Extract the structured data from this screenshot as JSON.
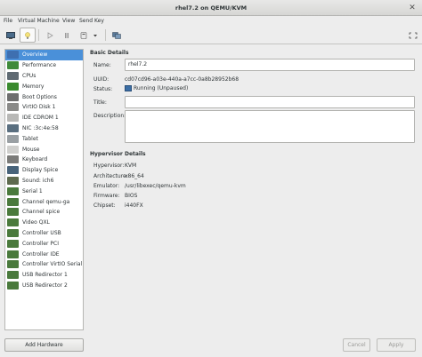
{
  "window": {
    "title": "rhel7.2 on QEMU/KVM"
  },
  "menu": [
    "File",
    "Virtual Machine",
    "View",
    "Send Key"
  ],
  "toolbar": {
    "buttons": [
      {
        "name": "console-icon"
      },
      {
        "name": "lightbulb-icon"
      },
      {
        "name": "play-icon"
      },
      {
        "name": "pause-icon"
      },
      {
        "name": "power-icon"
      },
      {
        "name": "chevron-down-icon"
      },
      {
        "name": "snapshot-icon"
      }
    ]
  },
  "sidebar": {
    "items": [
      {
        "label": "Overview",
        "icon": "overview-icon",
        "color": "#3e6fb0"
      },
      {
        "label": "Performance",
        "icon": "performance-icon",
        "color": "#3f8a3a"
      },
      {
        "label": "CPUs",
        "icon": "cpu-icon",
        "color": "#5f6a72"
      },
      {
        "label": "Memory",
        "icon": "memory-icon",
        "color": "#3a8a2e"
      },
      {
        "label": "Boot Options",
        "icon": "gear-icon",
        "color": "#6e6e6e"
      },
      {
        "label": "VirtIO Disk 1",
        "icon": "disk-icon",
        "color": "#8a8a88"
      },
      {
        "label": "IDE CDROM 1",
        "icon": "cdrom-icon",
        "color": "#b8b8b6"
      },
      {
        "label": "NIC :3c:4e:58",
        "icon": "nic-icon",
        "color": "#5a6f80"
      },
      {
        "label": "Tablet",
        "icon": "tablet-icon",
        "color": "#9aa0a4"
      },
      {
        "label": "Mouse",
        "icon": "mouse-icon",
        "color": "#cfcfcd"
      },
      {
        "label": "Keyboard",
        "icon": "keyboard-icon",
        "color": "#7b7b79"
      },
      {
        "label": "Display Spice",
        "icon": "display-icon",
        "color": "#48637a"
      },
      {
        "label": "Sound: ich6",
        "icon": "sound-icon",
        "color": "#5e6a4e"
      },
      {
        "label": "Serial 1",
        "icon": "serial-icon",
        "color": "#4a7a3c"
      },
      {
        "label": "Channel qemu-ga",
        "icon": "channel-icon",
        "color": "#4a7a3c"
      },
      {
        "label": "Channel spice",
        "icon": "channel-icon",
        "color": "#4a7a3c"
      },
      {
        "label": "Video QXL",
        "icon": "video-icon",
        "color": "#4a7a3c"
      },
      {
        "label": "Controller USB",
        "icon": "controller-icon",
        "color": "#4a7a3c"
      },
      {
        "label": "Controller PCI",
        "icon": "controller-icon",
        "color": "#4a7a3c"
      },
      {
        "label": "Controller IDE",
        "icon": "controller-icon",
        "color": "#4a7a3c"
      },
      {
        "label": "Controller VirtIO Serial",
        "icon": "controller-icon",
        "color": "#4a7a3c"
      },
      {
        "label": "USB Redirector 1",
        "icon": "usb-icon",
        "color": "#4a7a3c"
      },
      {
        "label": "USB Redirector 2",
        "icon": "usb-icon",
        "color": "#4a7a3c"
      }
    ],
    "add_label": "Add Hardware"
  },
  "details": {
    "basic_title": "Basic Details",
    "name_label": "Name:",
    "name_value": "rhel7.2",
    "uuid_label": "UUID:",
    "uuid_value": "cd07cd96-a03e-440a-a7cc-0a8b28952b68",
    "status_label": "Status:",
    "status_value": "Running (Unpaused)",
    "title_label": "Title:",
    "title_value": "",
    "description_label": "Description:",
    "description_value": "",
    "hypervisor_title": "Hypervisor Details",
    "hypervisor_label": "Hypervisor:",
    "hypervisor_value": "KVM",
    "arch_label": "Architecture:",
    "arch_value": "x86_64",
    "emulator_label": "Emulator:",
    "emulator_value": "/usr/libexec/qemu-kvm",
    "firmware_label": "Firmware:",
    "firmware_value": "BIOS",
    "chipset_label": "Chipset:",
    "chipset_value": "i440FX"
  },
  "buttons": {
    "cancel": "Cancel",
    "apply": "Apply"
  }
}
